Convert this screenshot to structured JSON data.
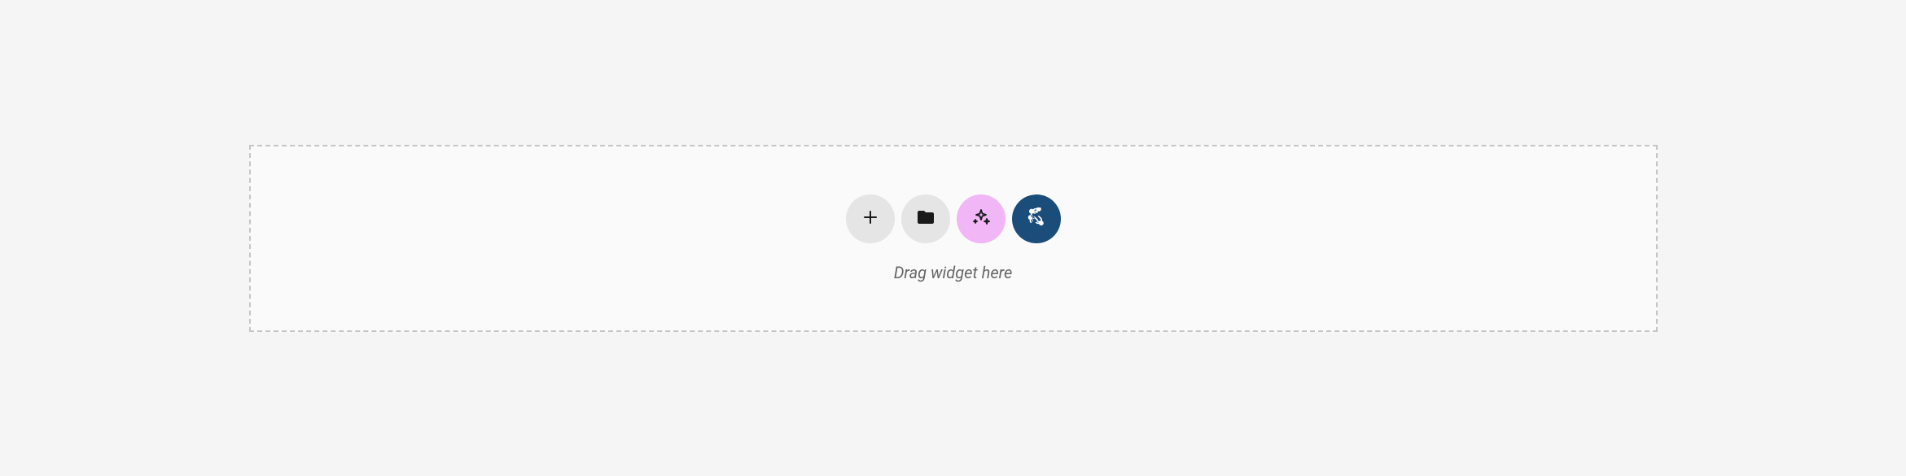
{
  "dropzone": {
    "helper_text": "Drag widget here",
    "buttons": {
      "add": {
        "name": "add-button",
        "icon": "plus-icon"
      },
      "folder": {
        "name": "folder-button",
        "icon": "folder-icon"
      },
      "ai": {
        "name": "ai-button",
        "icon": "sparkle-icon"
      },
      "joomla": {
        "name": "joomla-button",
        "icon": "joomla-icon"
      }
    }
  },
  "colors": {
    "add_bg": "#e5e5e5",
    "folder_bg": "#e5e5e5",
    "ai_bg": "#f0b6f5",
    "joomla_bg": "#1a4d7a"
  }
}
